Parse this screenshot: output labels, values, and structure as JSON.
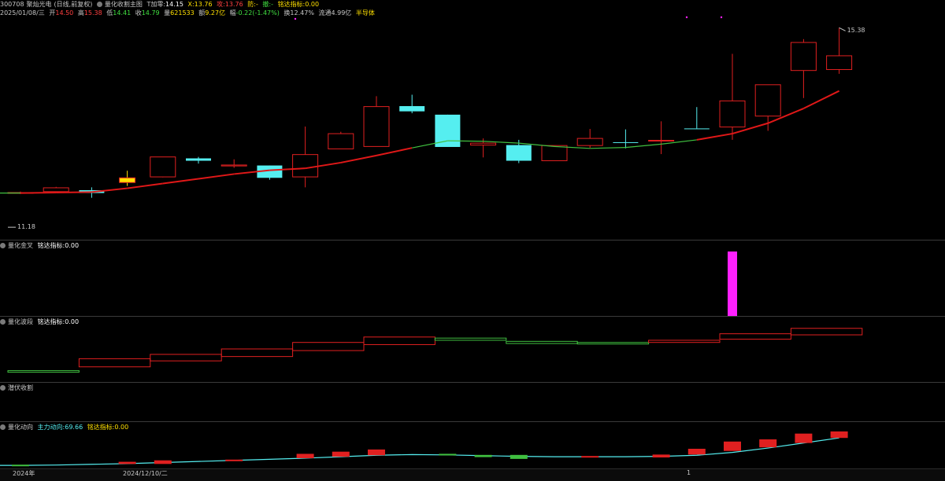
{
  "header": {
    "code": "300708",
    "name": "聚灿光电",
    "mode": "(日线,前复权)",
    "indicator_name": "量化收割主图",
    "t_label": "T加零:",
    "t_value": "14.15",
    "x_label": "X:",
    "x_value": "13.76",
    "attack_label": "攻:",
    "attack_value": "13.76",
    "defend_label": "防:",
    "defend_value": "-",
    "retreat_label": "撤:",
    "retreat_value": "-",
    "signal_label": "铭达指标:",
    "signal_value": "0.00"
  },
  "info": {
    "date": "2025/01/08/三",
    "open_label": "开",
    "open": "14.50",
    "high_label": "高",
    "high": "15.38",
    "low_label": "低",
    "low": "14.41",
    "close_label": "收",
    "close": "14.79",
    "volume_label": "量",
    "volume": "621533",
    "amount_label": "额",
    "amount": "9.27亿",
    "change_label": "幅",
    "change": "-0.22(-1.47%)",
    "turnover_label": "换",
    "turnover": "12.47%",
    "float_label": "流通",
    "float": "4.99亿",
    "sector": "半导体"
  },
  "panels": {
    "golden": {
      "title": "量化金叉",
      "signal_label": "铭达指标:",
      "signal_value": "0.00"
    },
    "wave": {
      "title": "量化波段",
      "signal_label": "铭达指标:",
      "signal_value": "0.00"
    },
    "lurk": {
      "title": "潜伏收割"
    },
    "flow": {
      "title": "量化动向",
      "main_label": "主力动向:",
      "main_value": "69.66",
      "signal_label": "铭达指标:",
      "signal_value": "0.00"
    }
  },
  "price_marks": {
    "high": "15.38",
    "low": "11.18"
  },
  "axis": {
    "year": "2024年",
    "date": "2024/12/10/二",
    "marker": "1"
  },
  "colors": {
    "up": "#e02020",
    "down": "#55eef0",
    "ma_red": "#e01818",
    "ma_green": "#40c040",
    "magenta": "#ff20ff",
    "yellow": "#ffe000"
  },
  "chart_data": {
    "type": "candlestick",
    "price_range": [
      11.0,
      15.6
    ],
    "candles": [
      {
        "o": 11.9,
        "h": 11.93,
        "l": 11.88,
        "c": 11.91,
        "color": "up"
      },
      {
        "o": 11.93,
        "h": 12.03,
        "l": 11.9,
        "c": 12.01,
        "color": "up"
      },
      {
        "o": 11.96,
        "h": 12.02,
        "l": 11.8,
        "c": 11.9,
        "color": "down"
      },
      {
        "o": 12.13,
        "h": 12.37,
        "l": 12.05,
        "c": 12.22,
        "color": "flat"
      },
      {
        "o": 12.24,
        "h": 12.66,
        "l": 12.23,
        "c": 12.66,
        "color": "up"
      },
      {
        "o": 12.63,
        "h": 12.66,
        "l": 12.52,
        "c": 12.58,
        "color": "down"
      },
      {
        "o": 12.49,
        "h": 12.61,
        "l": 12.43,
        "c": 12.47,
        "color": "up"
      },
      {
        "o": 12.48,
        "h": 12.48,
        "l": 12.18,
        "c": 12.22,
        "color": "down"
      },
      {
        "o": 12.24,
        "h": 13.3,
        "l": 12.02,
        "c": 12.71,
        "color": "up"
      },
      {
        "o": 12.83,
        "h": 13.19,
        "l": 12.83,
        "c": 13.15,
        "color": "up"
      },
      {
        "o": 12.88,
        "h": 13.94,
        "l": 12.88,
        "c": 13.72,
        "color": "up"
      },
      {
        "o": 13.73,
        "h": 13.97,
        "l": 13.58,
        "c": 13.62,
        "color": "down"
      },
      {
        "o": 13.55,
        "h": 13.55,
        "l": 12.87,
        "c": 12.87,
        "color": "down"
      },
      {
        "o": 12.91,
        "h": 13.05,
        "l": 12.65,
        "c": 12.95,
        "color": "up"
      },
      {
        "o": 12.91,
        "h": 13.02,
        "l": 12.53,
        "c": 12.58,
        "color": "down"
      },
      {
        "o": 12.58,
        "h": 12.9,
        "l": 12.58,
        "c": 12.9,
        "color": "up"
      },
      {
        "o": 12.9,
        "h": 13.25,
        "l": 12.85,
        "c": 13.05,
        "color": "up"
      },
      {
        "o": 12.97,
        "h": 13.24,
        "l": 12.84,
        "c": 12.97,
        "color": "down"
      },
      {
        "o": 13.01,
        "h": 13.41,
        "l": 12.72,
        "c": 13.01,
        "color": "up"
      },
      {
        "o": 13.26,
        "h": 13.71,
        "l": 13.26,
        "c": 13.26,
        "color": "down"
      },
      {
        "o": 13.29,
        "h": 14.83,
        "l": 13.02,
        "c": 13.84,
        "color": "up"
      },
      {
        "o": 13.52,
        "h": 14.18,
        "l": 13.21,
        "c": 14.18,
        "color": "up"
      },
      {
        "o": 14.48,
        "h": 15.14,
        "l": 13.9,
        "c": 15.07,
        "color": "up"
      },
      {
        "o": 14.79,
        "h": 15.38,
        "l": 14.41,
        "c": 14.5,
        "color": "up"
      }
    ],
    "ma": [
      11.9,
      11.91,
      11.92,
      12.0,
      12.1,
      12.2,
      12.3,
      12.38,
      12.42,
      12.54,
      12.69,
      12.85,
      13.0,
      12.99,
      12.95,
      12.88,
      12.84,
      12.86,
      12.93,
      13.02,
      13.15,
      13.37,
      13.68,
      14.05
    ],
    "ma_green_range": [
      11,
      19
    ],
    "golden_bars": [
      {
        "index": 20,
        "value": 1
      }
    ],
    "wave_steps": [
      {
        "from": 0,
        "to": 2,
        "low": 0.18,
        "high": 0.18,
        "color": "green"
      },
      {
        "from": 2,
        "to": 4,
        "low": 0.25,
        "high": 0.4,
        "color": "red"
      },
      {
        "from": 4,
        "to": 6,
        "low": 0.36,
        "high": 0.48,
        "color": "red"
      },
      {
        "from": 6,
        "to": 8,
        "low": 0.44,
        "high": 0.58,
        "color": "red"
      },
      {
        "from": 8,
        "to": 10,
        "low": 0.55,
        "high": 0.7,
        "color": "red"
      },
      {
        "from": 10,
        "to": 12,
        "low": 0.66,
        "high": 0.8,
        "color": "red"
      },
      {
        "from": 12,
        "to": 14,
        "low": 0.74,
        "high": 0.78,
        "color": "green"
      },
      {
        "from": 14,
        "to": 16,
        "low": 0.68,
        "high": 0.72,
        "color": "green"
      },
      {
        "from": 16,
        "to": 18,
        "low": 0.68,
        "high": 0.7,
        "color": "green"
      },
      {
        "from": 18,
        "to": 20,
        "low": 0.7,
        "high": 0.74,
        "color": "red"
      },
      {
        "from": 20,
        "to": 22,
        "low": 0.76,
        "high": 0.86,
        "color": "red"
      },
      {
        "from": 22,
        "to": 24,
        "low": 0.84,
        "high": 0.96,
        "color": "red"
      }
    ],
    "flow_line": [
      0.04,
      0.05,
      0.07,
      0.09,
      0.12,
      0.15,
      0.18,
      0.21,
      0.24,
      0.28,
      0.32,
      0.34,
      0.33,
      0.31,
      0.29,
      0.28,
      0.28,
      0.28,
      0.29,
      0.32,
      0.4,
      0.52,
      0.66,
      0.8
    ],
    "flow_bars": [
      {
        "index": 0,
        "top": 0.06,
        "bottom": 0.02,
        "color": "green"
      },
      {
        "index": 3,
        "top": 0.14,
        "bottom": 0.08,
        "color": "red"
      },
      {
        "index": 4,
        "top": 0.18,
        "bottom": 0.08,
        "color": "red"
      },
      {
        "index": 6,
        "top": 0.2,
        "bottom": 0.16,
        "color": "red"
      },
      {
        "index": 8,
        "top": 0.36,
        "bottom": 0.24,
        "color": "red"
      },
      {
        "index": 9,
        "top": 0.42,
        "bottom": 0.28,
        "color": "red"
      },
      {
        "index": 10,
        "top": 0.48,
        "bottom": 0.32,
        "color": "red"
      },
      {
        "index": 12,
        "top": 0.36,
        "bottom": 0.33,
        "color": "green"
      },
      {
        "index": 13,
        "top": 0.33,
        "bottom": 0.27,
        "color": "green"
      },
      {
        "index": 14,
        "top": 0.33,
        "bottom": 0.22,
        "color": "green"
      },
      {
        "index": 16,
        "top": 0.3,
        "bottom": 0.27,
        "color": "red"
      },
      {
        "index": 18,
        "top": 0.34,
        "bottom": 0.26,
        "color": "red"
      },
      {
        "index": 19,
        "top": 0.5,
        "bottom": 0.34,
        "color": "red"
      },
      {
        "index": 20,
        "top": 0.7,
        "bottom": 0.44,
        "color": "red"
      },
      {
        "index": 21,
        "top": 0.76,
        "bottom": 0.54,
        "color": "red"
      },
      {
        "index": 22,
        "top": 0.92,
        "bottom": 0.66,
        "color": "red"
      },
      {
        "index": 23,
        "top": 0.98,
        "bottom": 0.8,
        "color": "red"
      }
    ]
  }
}
